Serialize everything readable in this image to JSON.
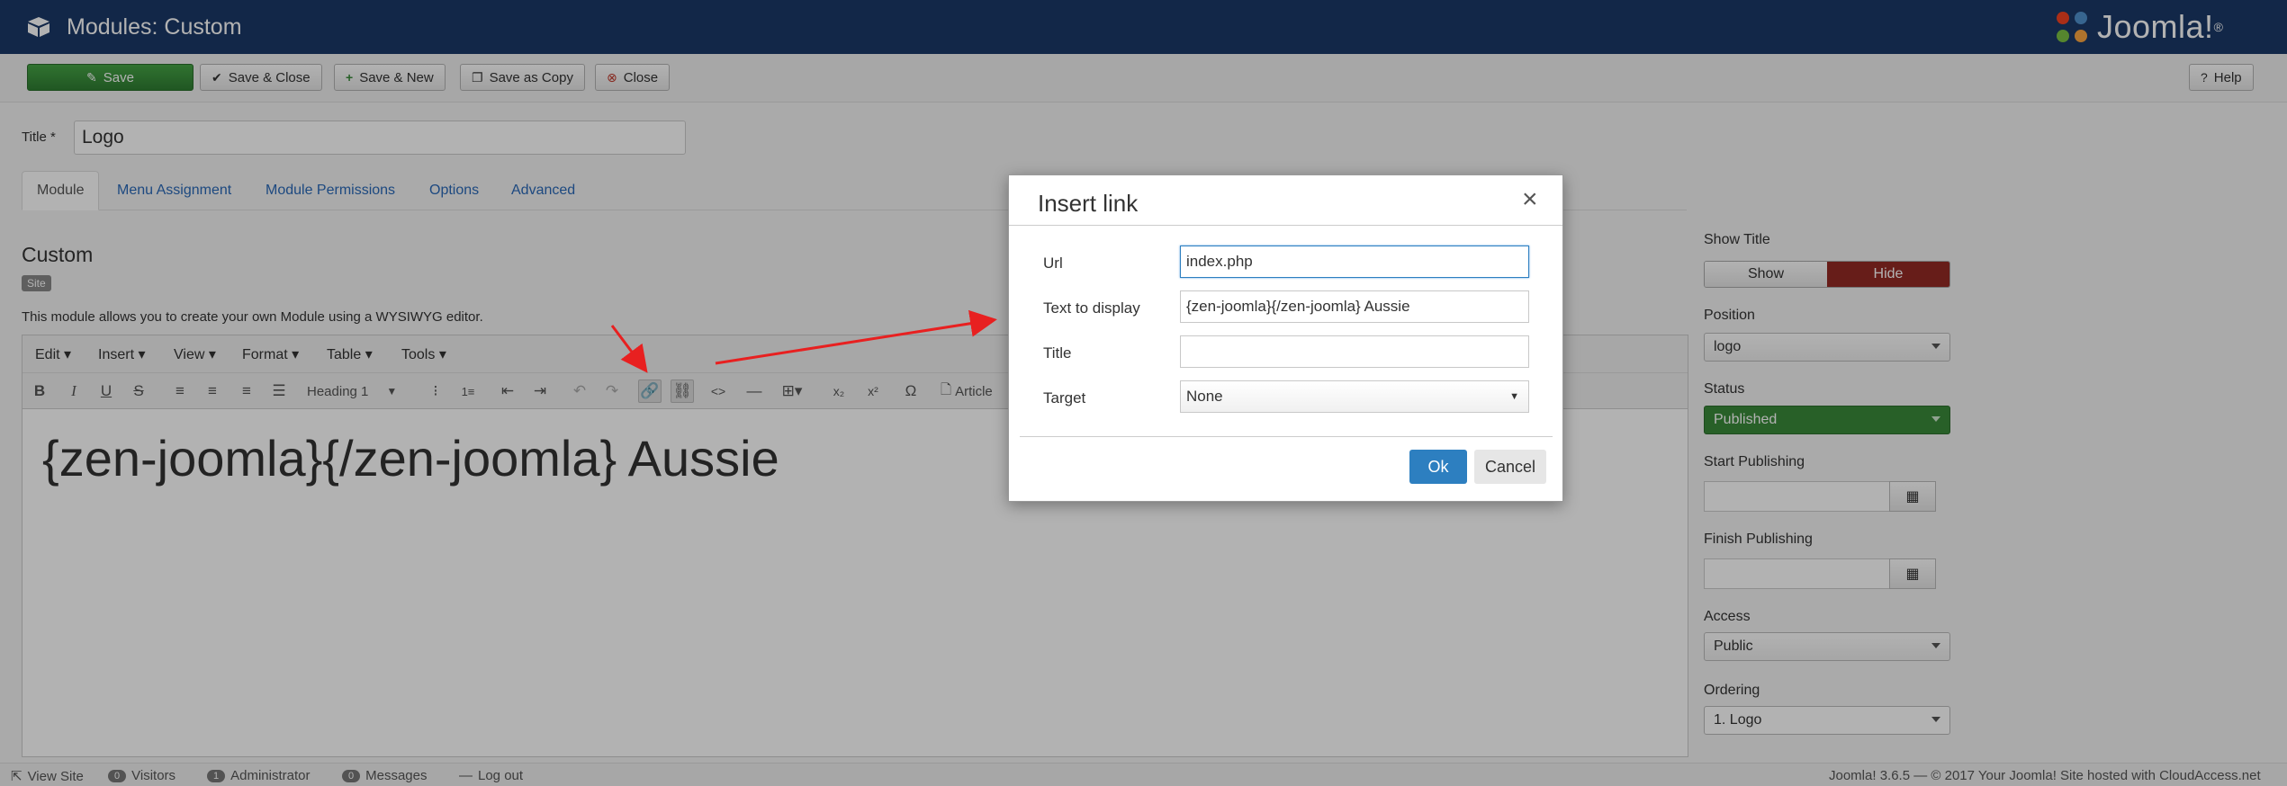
{
  "header": {
    "title": "Modules: Custom",
    "logo_text": "Joomla!",
    "logo_trademark": "®"
  },
  "toolbar": {
    "save": "Save",
    "save_close": "Save & Close",
    "save_new": "Save & New",
    "save_copy": "Save as Copy",
    "close": "Close",
    "help": "Help"
  },
  "form": {
    "title_label": "Title *",
    "title_value": "Logo",
    "tabs": [
      "Module",
      "Menu Assignment",
      "Module Permissions",
      "Options",
      "Advanced"
    ],
    "section_title": "Custom",
    "badge": "Site",
    "description": "This module allows you to create your own Module using a WYSIWYG editor."
  },
  "editor": {
    "menus": [
      "Edit",
      "Insert",
      "View",
      "Format",
      "Table",
      "Tools"
    ],
    "format_select": "Heading 1",
    "article_button": "Article",
    "content": "{zen-joomla}{/zen-joomla} Aussie"
  },
  "right_panel": {
    "show_title_label": "Show Title",
    "show": "Show",
    "hide": "Hide",
    "position_label": "Position",
    "position_value": "logo",
    "status_label": "Status",
    "status_value": "Published",
    "start_publishing_label": "Start Publishing",
    "finish_publishing_label": "Finish Publishing",
    "access_label": "Access",
    "access_value": "Public",
    "ordering_label": "Ordering",
    "ordering_value": "1. Logo"
  },
  "modal": {
    "title": "Insert link",
    "url_label": "Url",
    "url_value": "index.php",
    "text_label": "Text to display",
    "text_value": "{zen-joomla}{/zen-joomla} Aussie",
    "title_label": "Title",
    "title_value": "",
    "target_label": "Target",
    "target_value": "None",
    "ok": "Ok",
    "cancel": "Cancel"
  },
  "statusbar": {
    "view_site": "View Site",
    "visitors_count": "0",
    "visitors": "Visitors",
    "admin_count": "1",
    "administrator": "Administrator",
    "messages_count": "0",
    "messages": "Messages",
    "logout": "Log out",
    "footer": "Joomla! 3.6.5  —  © 2017 Your Joomla! Site hosted with CloudAccess.net"
  },
  "colors": {
    "header_bg": "#1a3867",
    "save_green": "#2f7d32",
    "hide_red": "#942a25",
    "published_green": "#3a8a3a",
    "ok_blue": "#2d7fc0",
    "arrow_red": "#e82020"
  }
}
